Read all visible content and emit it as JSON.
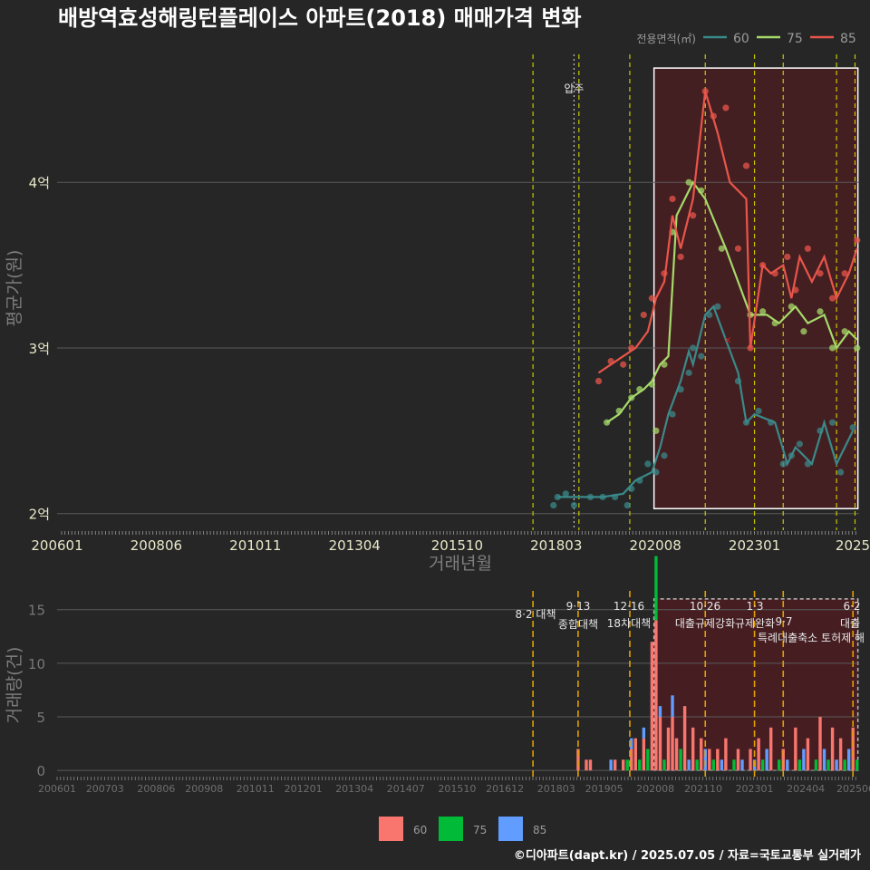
{
  "title": "배방역효성해링턴플레이스 아파트(2018) 매매가격 변화",
  "credit": "©디아파트(dapt.kr) / 2025.07.05 / 자료=국토교통부 실거래가",
  "colors": {
    "background": "#262626",
    "grid": "#5a5a5a",
    "policy_line": "#c8c800",
    "policy_line_bottom": "#e0a000",
    "highlight_fill": "#4a1e22",
    "s60": "#3a8a8a",
    "s75": "#a6d96a",
    "s85": "#e8554a",
    "bar60": "#f8766d",
    "bar75": "#00ba38",
    "bar85": "#619cff"
  },
  "legend_top": {
    "title": "전용면적(㎡)",
    "items": [
      "60",
      "75",
      "85"
    ]
  },
  "legend_bottom": {
    "items": [
      "60",
      "75",
      "85"
    ]
  },
  "chart_data": [
    {
      "type": "line",
      "panel": "price",
      "xlabel": "거래년월",
      "ylabel": "평균가(원)",
      "x_ticks": [
        "200601",
        "200806",
        "201011",
        "201304",
        "201510",
        "201803",
        "202008",
        "202301",
        "2025"
      ],
      "y_ticks": [
        {
          "value": 2.0,
          "label": "2억"
        },
        {
          "value": 3.0,
          "label": "3억"
        },
        {
          "value": 4.0,
          "label": "4억"
        }
      ],
      "ylim": [
        1.9,
        4.8
      ],
      "annotation": "압주",
      "series": [
        {
          "name": "60",
          "line": [
            [
              2018.2,
              2.1
            ],
            [
              2018.6,
              2.1
            ],
            [
              2019.3,
              2.1
            ],
            [
              2019.8,
              2.12
            ],
            [
              2020.1,
              2.2
            ],
            [
              2020.5,
              2.25
            ],
            [
              2020.7,
              2.4
            ],
            [
              2020.9,
              2.6
            ],
            [
              2021.2,
              2.8
            ],
            [
              2021.4,
              2.98
            ],
            [
              2021.5,
              2.9
            ],
            [
              2021.8,
              3.2
            ],
            [
              2022.0,
              3.25
            ],
            [
              2022.6,
              2.85
            ],
            [
              2022.8,
              2.55
            ],
            [
              2023.0,
              2.6
            ],
            [
              2023.5,
              2.55
            ],
            [
              2023.8,
              2.3
            ],
            [
              2024.0,
              2.4
            ],
            [
              2024.4,
              2.3
            ],
            [
              2024.7,
              2.55
            ],
            [
              2025.0,
              2.3
            ],
            [
              2025.4,
              2.5
            ]
          ],
          "points": [
            [
              2018.1,
              2.05
            ],
            [
              2018.2,
              2.1
            ],
            [
              2018.4,
              2.12
            ],
            [
              2018.6,
              2.05
            ],
            [
              2019.0,
              2.1
            ],
            [
              2019.3,
              2.1
            ],
            [
              2019.6,
              2.1
            ],
            [
              2019.9,
              2.05
            ],
            [
              2020.0,
              2.15
            ],
            [
              2020.2,
              2.2
            ],
            [
              2020.4,
              2.3
            ],
            [
              2020.6,
              2.25
            ],
            [
              2020.8,
              2.35
            ],
            [
              2021.0,
              2.6
            ],
            [
              2021.2,
              2.75
            ],
            [
              2021.4,
              2.85
            ],
            [
              2021.5,
              3.0
            ],
            [
              2021.7,
              2.95
            ],
            [
              2021.9,
              3.2
            ],
            [
              2022.1,
              3.25
            ],
            [
              2022.6,
              2.8
            ],
            [
              2022.8,
              2.55
            ],
            [
              2023.1,
              2.62
            ],
            [
              2023.4,
              2.55
            ],
            [
              2023.7,
              2.3
            ],
            [
              2023.9,
              2.35
            ],
            [
              2024.1,
              2.42
            ],
            [
              2024.3,
              2.3
            ],
            [
              2024.6,
              2.5
            ],
            [
              2024.9,
              2.55
            ],
            [
              2025.1,
              2.25
            ],
            [
              2025.4,
              2.52
            ]
          ]
        },
        {
          "name": "75",
          "line": [
            [
              2019.4,
              2.55
            ],
            [
              2019.7,
              2.6
            ],
            [
              2020.0,
              2.7
            ],
            [
              2020.3,
              2.75
            ],
            [
              2020.5,
              2.8
            ],
            [
              2020.7,
              2.9
            ],
            [
              2020.9,
              2.95
            ],
            [
              2021.1,
              3.8
            ],
            [
              2021.5,
              4.0
            ],
            [
              2021.8,
              3.9
            ],
            [
              2022.3,
              3.6
            ],
            [
              2022.9,
              3.2
            ],
            [
              2023.3,
              3.2
            ],
            [
              2023.6,
              3.15
            ],
            [
              2024.0,
              3.25
            ],
            [
              2024.3,
              3.15
            ],
            [
              2024.7,
              3.2
            ],
            [
              2025.0,
              3.0
            ],
            [
              2025.3,
              3.1
            ],
            [
              2025.5,
              3.05
            ]
          ],
          "points": [
            [
              2019.4,
              2.55
            ],
            [
              2019.7,
              2.62
            ],
            [
              2020.0,
              2.7
            ],
            [
              2020.2,
              2.75
            ],
            [
              2020.5,
              2.78
            ],
            [
              2020.6,
              2.5
            ],
            [
              2020.8,
              2.9
            ],
            [
              2021.0,
              3.7
            ],
            [
              2021.4,
              4.0
            ],
            [
              2021.7,
              3.95
            ],
            [
              2022.2,
              3.6
            ],
            [
              2022.9,
              3.2
            ],
            [
              2023.2,
              3.22
            ],
            [
              2023.5,
              3.15
            ],
            [
              2023.9,
              3.25
            ],
            [
              2024.2,
              3.1
            ],
            [
              2024.6,
              3.22
            ],
            [
              2024.9,
              3.0
            ],
            [
              2025.2,
              3.1
            ],
            [
              2025.5,
              3.0
            ]
          ]
        },
        {
          "name": "85",
          "line": [
            [
              2019.2,
              2.85
            ],
            [
              2019.5,
              2.9
            ],
            [
              2019.8,
              2.95
            ],
            [
              2020.1,
              3.0
            ],
            [
              2020.4,
              3.1
            ],
            [
              2020.6,
              3.3
            ],
            [
              2020.8,
              3.4
            ],
            [
              2021.0,
              3.8
            ],
            [
              2021.2,
              3.6
            ],
            [
              2021.5,
              3.9
            ],
            [
              2021.8,
              4.55
            ],
            [
              2022.1,
              4.3
            ],
            [
              2022.4,
              4.0
            ],
            [
              2022.8,
              3.9
            ],
            [
              2022.9,
              3.0
            ],
            [
              2023.2,
              3.5
            ],
            [
              2023.4,
              3.45
            ],
            [
              2023.7,
              3.5
            ],
            [
              2023.9,
              3.3
            ],
            [
              2024.1,
              3.55
            ],
            [
              2024.4,
              3.4
            ],
            [
              2024.7,
              3.55
            ],
            [
              2025.0,
              3.3
            ],
            [
              2025.3,
              3.45
            ],
            [
              2025.5,
              3.6
            ]
          ],
          "points": [
            [
              2019.2,
              2.8
            ],
            [
              2019.5,
              2.92
            ],
            [
              2019.8,
              2.9
            ],
            [
              2020.0,
              3.0
            ],
            [
              2020.3,
              3.2
            ],
            [
              2020.5,
              3.3
            ],
            [
              2020.8,
              3.45
            ],
            [
              2021.0,
              3.9
            ],
            [
              2021.2,
              3.55
            ],
            [
              2021.5,
              3.8
            ],
            [
              2021.8,
              4.55
            ],
            [
              2022.0,
              4.4
            ],
            [
              2022.3,
              4.45
            ],
            [
              2022.6,
              3.6
            ],
            [
              2022.8,
              4.1
            ],
            [
              2022.9,
              3.0
            ],
            [
              2023.2,
              3.5
            ],
            [
              2023.5,
              3.45
            ],
            [
              2023.8,
              3.55
            ],
            [
              2024.0,
              3.35
            ],
            [
              2024.3,
              3.6
            ],
            [
              2024.6,
              3.45
            ],
            [
              2024.9,
              3.3
            ],
            [
              2025.2,
              3.45
            ],
            [
              2025.5,
              3.65
            ]
          ]
        }
      ]
    },
    {
      "type": "bar",
      "panel": "volume",
      "ylabel": "거래량(건)",
      "x_ticks": [
        "200601",
        "200703",
        "200806",
        "200908",
        "201011",
        "201201",
        "201304",
        "201407",
        "201510",
        "201612",
        "201803",
        "201905",
        "202008",
        "202110",
        "202301",
        "202404",
        "202506"
      ],
      "y_ticks": [
        0,
        5,
        10,
        15
      ],
      "ylim": [
        -0.5,
        16.5
      ],
      "policies": [
        {
          "date": "8·2 대책",
          "x": 2017.6
        },
        {
          "date": "9·13",
          "label": "종합대책",
          "x": 2018.7
        },
        {
          "date": "12·16",
          "label": "18차대책",
          "x": 2019.96
        },
        {
          "date": "10·26",
          "label": "대출규제강화",
          "x": 2021.8
        },
        {
          "date": "1·3",
          "label": "규제완화",
          "x": 2023.0
        },
        {
          "date": "9·7",
          "label": "특례대출축소 토허제 해",
          "x": 2023.7
        },
        {
          "date": "6·2",
          "label": "대출",
          "x": 2025.4
        }
      ],
      "series": [
        {
          "name": "60",
          "values": [
            [
              2018.7,
              2
            ],
            [
              2018.9,
              1
            ],
            [
              2019.0,
              1
            ],
            [
              2019.6,
              1
            ],
            [
              2019.8,
              1
            ],
            [
              2020.0,
              2
            ],
            [
              2020.1,
              3
            ],
            [
              2020.3,
              3
            ],
            [
              2020.5,
              12
            ],
            [
              2020.6,
              14
            ],
            [
              2020.7,
              5
            ],
            [
              2020.9,
              4
            ],
            [
              2021.0,
              5
            ],
            [
              2021.1,
              3
            ],
            [
              2021.3,
              6
            ],
            [
              2021.5,
              4
            ],
            [
              2021.7,
              3
            ],
            [
              2021.9,
              2
            ],
            [
              2022.1,
              2
            ],
            [
              2022.3,
              3
            ],
            [
              2022.6,
              2
            ],
            [
              2022.9,
              2
            ],
            [
              2023.1,
              3
            ],
            [
              2023.4,
              4
            ],
            [
              2023.7,
              2
            ],
            [
              2024.0,
              4
            ],
            [
              2024.3,
              3
            ],
            [
              2024.6,
              5
            ],
            [
              2024.9,
              4
            ],
            [
              2025.1,
              3
            ],
            [
              2025.4,
              4
            ]
          ]
        },
        {
          "name": "75",
          "values": [
            [
              2019.9,
              1
            ],
            [
              2020.2,
              1
            ],
            [
              2020.4,
              2
            ],
            [
              2020.6,
              6
            ],
            [
              2020.8,
              1
            ],
            [
              2021.2,
              2
            ],
            [
              2021.6,
              1
            ],
            [
              2022.0,
              1
            ],
            [
              2022.5,
              1
            ],
            [
              2023.2,
              1
            ],
            [
              2023.6,
              1
            ],
            [
              2024.1,
              1
            ],
            [
              2024.5,
              1
            ],
            [
              2024.8,
              1
            ],
            [
              2025.2,
              1
            ],
            [
              2025.5,
              1
            ]
          ]
        },
        {
          "name": "85",
          "values": [
            [
              2019.5,
              1
            ],
            [
              2020.0,
              1
            ],
            [
              2020.3,
              1
            ],
            [
              2020.7,
              1
            ],
            [
              2021.0,
              2
            ],
            [
              2021.4,
              1
            ],
            [
              2021.8,
              2
            ],
            [
              2022.2,
              1
            ],
            [
              2022.7,
              1
            ],
            [
              2023.0,
              1
            ],
            [
              2023.3,
              2
            ],
            [
              2023.8,
              1
            ],
            [
              2024.2,
              2
            ],
            [
              2024.7,
              2
            ],
            [
              2025.0,
              1
            ],
            [
              2025.3,
              2
            ]
          ]
        }
      ]
    }
  ]
}
